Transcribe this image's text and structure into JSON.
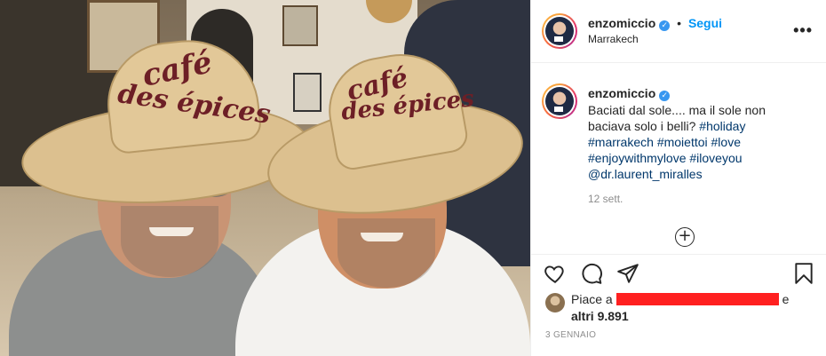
{
  "header": {
    "username": "enzomiccio",
    "follow_label": "Segui",
    "separator": "•",
    "location": "Marrakech",
    "more_icon": "more-options-icon"
  },
  "photo": {
    "hat_left_line1": "café",
    "hat_left_line2": "des épices",
    "hat_right_line1": "café",
    "hat_right_line2": "des épices"
  },
  "caption": {
    "username": "enzomiccio",
    "text": "Baciati dal sole.... ma il sole non baciava solo i belli?",
    "hashtags": [
      "#holiday",
      "#marrakech",
      "#moiettoi",
      "#love",
      "#enjoywithmylove",
      "#iloveyou",
      "@dr.laurent_miralles"
    ],
    "time_ago": "12 sett."
  },
  "load_more_icon": "plus-circle-icon",
  "actions": {
    "like_icon": "heart-icon",
    "comment_icon": "comment-icon",
    "share_icon": "share-icon",
    "save_icon": "bookmark-icon"
  },
  "likes": {
    "prefix": "Piace a",
    "suffix": "e",
    "others": "altri 9.891"
  },
  "post_date": "3 GENNAIO",
  "colors": {
    "link_blue": "#0095f6",
    "hashtag": "#00376b",
    "muted": "#8e8e8e",
    "redaction": "#ff2020"
  }
}
